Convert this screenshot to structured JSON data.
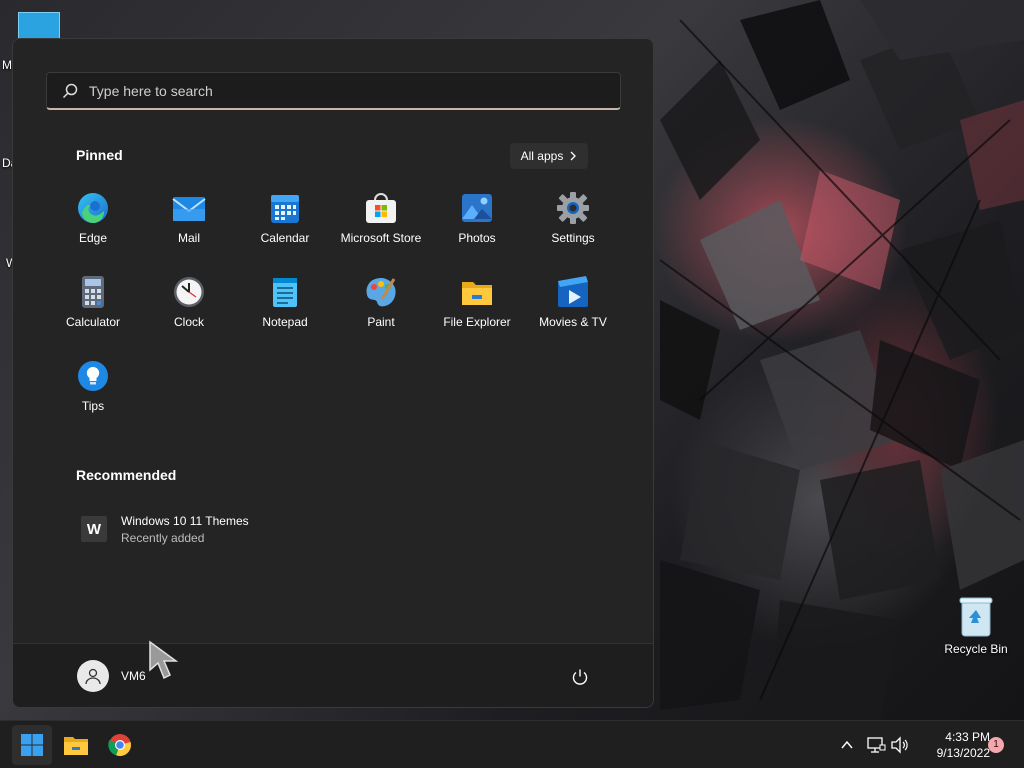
{
  "desktop": {
    "side_labels": [
      "M",
      "Da",
      "W"
    ],
    "recycle_bin_label": "Recycle Bin"
  },
  "start_menu": {
    "search": {
      "placeholder": "Type here to search"
    },
    "pinned": {
      "title": "Pinned",
      "all_apps_label": "All apps",
      "apps": [
        {
          "label": "Edge",
          "icon": "edge-icon"
        },
        {
          "label": "Mail",
          "icon": "mail-icon"
        },
        {
          "label": "Calendar",
          "icon": "calendar-icon"
        },
        {
          "label": "Microsoft Store",
          "icon": "store-icon"
        },
        {
          "label": "Photos",
          "icon": "photos-icon"
        },
        {
          "label": "Settings",
          "icon": "gear-icon"
        },
        {
          "label": "Calculator",
          "icon": "calculator-icon"
        },
        {
          "label": "Clock",
          "icon": "clock-icon"
        },
        {
          "label": "Notepad",
          "icon": "notepad-icon"
        },
        {
          "label": "Paint",
          "icon": "paint-icon"
        },
        {
          "label": "File Explorer",
          "icon": "folder-icon"
        },
        {
          "label": "Movies & TV",
          "icon": "movies-icon"
        },
        {
          "label": "Tips",
          "icon": "lightbulb-icon"
        }
      ]
    },
    "recommended": {
      "title": "Recommended",
      "items": [
        {
          "icon_letter": "W",
          "title": "Windows 10 11 Themes",
          "subtitle": "Recently added"
        }
      ]
    },
    "user": {
      "name": "VM6"
    }
  },
  "taskbar": {
    "time": "4:33 PM",
    "date": "9/13/2022",
    "notification_count": "1"
  },
  "colors": {
    "menu_bg": "#242424",
    "taskbar_bg": "#1f1f1f",
    "search_accent": "#c9b5a8",
    "notification_badge": "#f4a7ad"
  }
}
